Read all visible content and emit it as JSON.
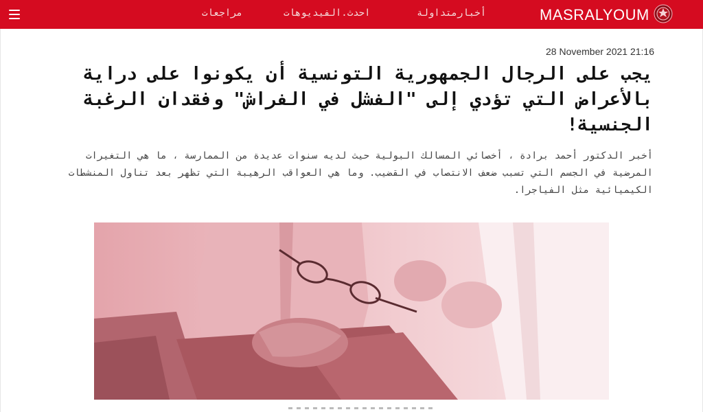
{
  "header": {
    "brand": "MASRALYOUM",
    "nav": [
      "مراجعات",
      "احدث.الفيديوهات",
      "أخبارمتداولة"
    ],
    "logo_icon": "crest-logo-icon",
    "menu_icon": "hamburger-menu-icon",
    "accent_color": "#d50b20"
  },
  "article": {
    "date": "28 November 2021 21:16",
    "title": "يجب على الرجال الجمهورية التونسية أن يكونوا على دراية بالأعراض التي تؤدي إلى \"الفشل في الفراش\" وفقدان الرغبة الجنسية!",
    "lede": "أخبر الدكتور أحمد برادة ، أخصائي المسالك البولية حيث لديه سنوات عديدة من الممارسة ، ما هي التغيرات المرضية في الجسم التي تسبب ضعف الانتصاب في القضيب. وما هي العواقب الرهيبة التي تظهر بعد تناول المنشطات الكيميائية مثل الفياجرا."
  }
}
